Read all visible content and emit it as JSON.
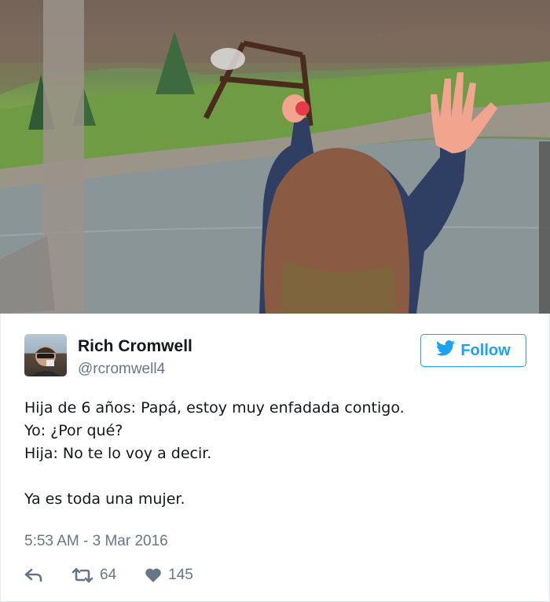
{
  "tweet": {
    "author_name": "Rich Cromwell",
    "author_handle": "@rcromwell4",
    "follow_label": "Follow",
    "text_lines": [
      "Hija de 6 años: Papá, estoy muy enfadada contigo.",
      "Yo: ¿Por qué?",
      "Hija: No te lo voy a decir.",
      "",
      "Ya es toda una mujer."
    ],
    "timestamp": "5:53 AM - 3 Mar 2016",
    "retweet_count": "64",
    "like_count": "145"
  },
  "icons": {
    "bird": "twitter-bird-icon",
    "reply": "reply-icon",
    "retweet": "retweet-icon",
    "like": "heart-icon"
  },
  "colors": {
    "accent": "#1da1f2",
    "secondary_text": "#657786",
    "primary_text": "#14171a",
    "border": "#e1e8ed"
  }
}
